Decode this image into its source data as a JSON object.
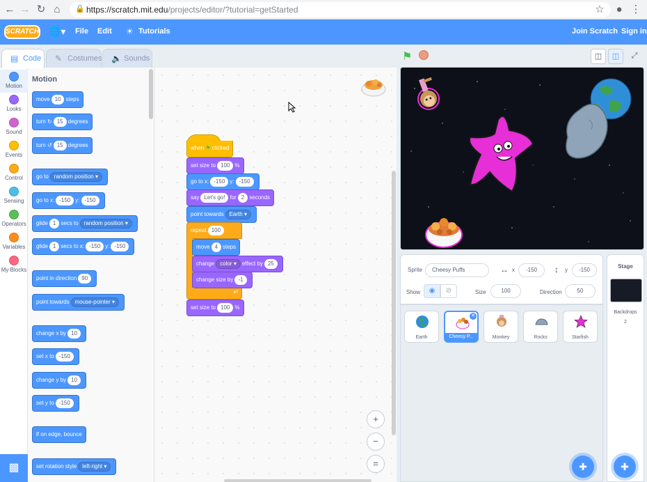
{
  "browser": {
    "url_host": "https://scratch.mit.edu",
    "url_path": "/projects/editor/?tutorial=getStarted"
  },
  "menu": {
    "logo": "SCRATCH",
    "file": "File",
    "edit": "Edit",
    "tutorials": "Tutorials",
    "join": "Join Scratch",
    "signin": "Sign in"
  },
  "tabs": {
    "code": "Code",
    "costumes": "Costumes",
    "sounds": "Sounds"
  },
  "categories": [
    {
      "label": "Motion",
      "color": "#4c97ff"
    },
    {
      "label": "Looks",
      "color": "#9966ff"
    },
    {
      "label": "Sound",
      "color": "#cf63cf"
    },
    {
      "label": "Events",
      "color": "#ffbf00"
    },
    {
      "label": "Control",
      "color": "#ffab19"
    },
    {
      "label": "Sensing",
      "color": "#4cbfe6"
    },
    {
      "label": "Operators",
      "color": "#59c059"
    },
    {
      "label": "Variables",
      "color": "#ff8c1a"
    },
    {
      "label": "My Blocks",
      "color": "#ff6680"
    }
  ],
  "palette": {
    "title": "Motion",
    "move": {
      "a": "move",
      "v": "10",
      "b": "steps"
    },
    "turn_cw": {
      "a": "turn",
      "v": "15",
      "b": "degrees"
    },
    "turn_ccw": {
      "a": "turn",
      "v": "15",
      "b": "degrees"
    },
    "goto": {
      "a": "go to",
      "v": "random position"
    },
    "gotoxy": {
      "a": "go to x:",
      "x": "-150",
      "ylab": "y:",
      "y": "-150"
    },
    "glide1": {
      "a": "glide",
      "v": "1",
      "b": "secs to",
      "t": "random position"
    },
    "glide2": {
      "a": "glide",
      "v": "1",
      "b": "secs to x:",
      "x": "-150",
      "ylab": "y:",
      "y": "-150"
    },
    "point_dir": {
      "a": "point in direction",
      "v": "90"
    },
    "point_towards": {
      "a": "point towards",
      "v": "mouse-pointer"
    },
    "change_x": {
      "a": "change x by",
      "v": "10"
    },
    "set_x": {
      "a": "set x to",
      "v": "-150"
    },
    "change_y": {
      "a": "change y by",
      "v": "10"
    },
    "set_y": {
      "a": "set y to",
      "v": "-150"
    },
    "bounce": {
      "a": "if on edge, bounce"
    },
    "rot_style": {
      "a": "set rotation style",
      "v": "left-right"
    }
  },
  "script": {
    "hat": {
      "a": "when",
      "b": "clicked"
    },
    "set_size1": {
      "a": "set size to",
      "v": "100",
      "b": "%"
    },
    "goto": {
      "a": "go to x:",
      "x": "-150",
      "ylab": "y:",
      "y": "-150"
    },
    "say": {
      "a": "say",
      "msg": "Let's go!",
      "b": "for",
      "v": "2",
      "c": "seconds"
    },
    "point": {
      "a": "point towards",
      "v": "Earth"
    },
    "repeat": {
      "a": "repeat",
      "v": "100"
    },
    "move": {
      "a": "move",
      "v": "4",
      "b": "steps"
    },
    "effect": {
      "a": "change",
      "d": "color",
      "b": "effect by",
      "v": "25"
    },
    "change_size": {
      "a": "change size by",
      "v": "-1"
    },
    "set_size2": {
      "a": "set size to",
      "v": "100",
      "b": "%"
    }
  },
  "zoom": {
    "in": "+",
    "out": "−",
    "reset": "="
  },
  "sprite_info": {
    "sprite_label": "Sprite",
    "sprite_name": "Cheesy Puffs",
    "x_label": "x",
    "x_value": "-150",
    "y_label": "y",
    "y_value": "-150",
    "show_label": "Show",
    "size_label": "Size",
    "size_value": "100",
    "direction_label": "Direction",
    "direction_value": "50"
  },
  "sprites": [
    {
      "name": "Earth",
      "color": "#3fa34d"
    },
    {
      "name": "Cheesy P...",
      "color": "#e07b39"
    },
    {
      "name": "Monkey",
      "color": "#e6a0c8"
    },
    {
      "name": "Rocks",
      "color": "#8fa4b8"
    },
    {
      "name": "Starfish",
      "color": "#e62fd6"
    }
  ],
  "stage_panel": {
    "title": "Stage",
    "backdrops_label": "Backdrops",
    "backdrops_count": "2"
  }
}
